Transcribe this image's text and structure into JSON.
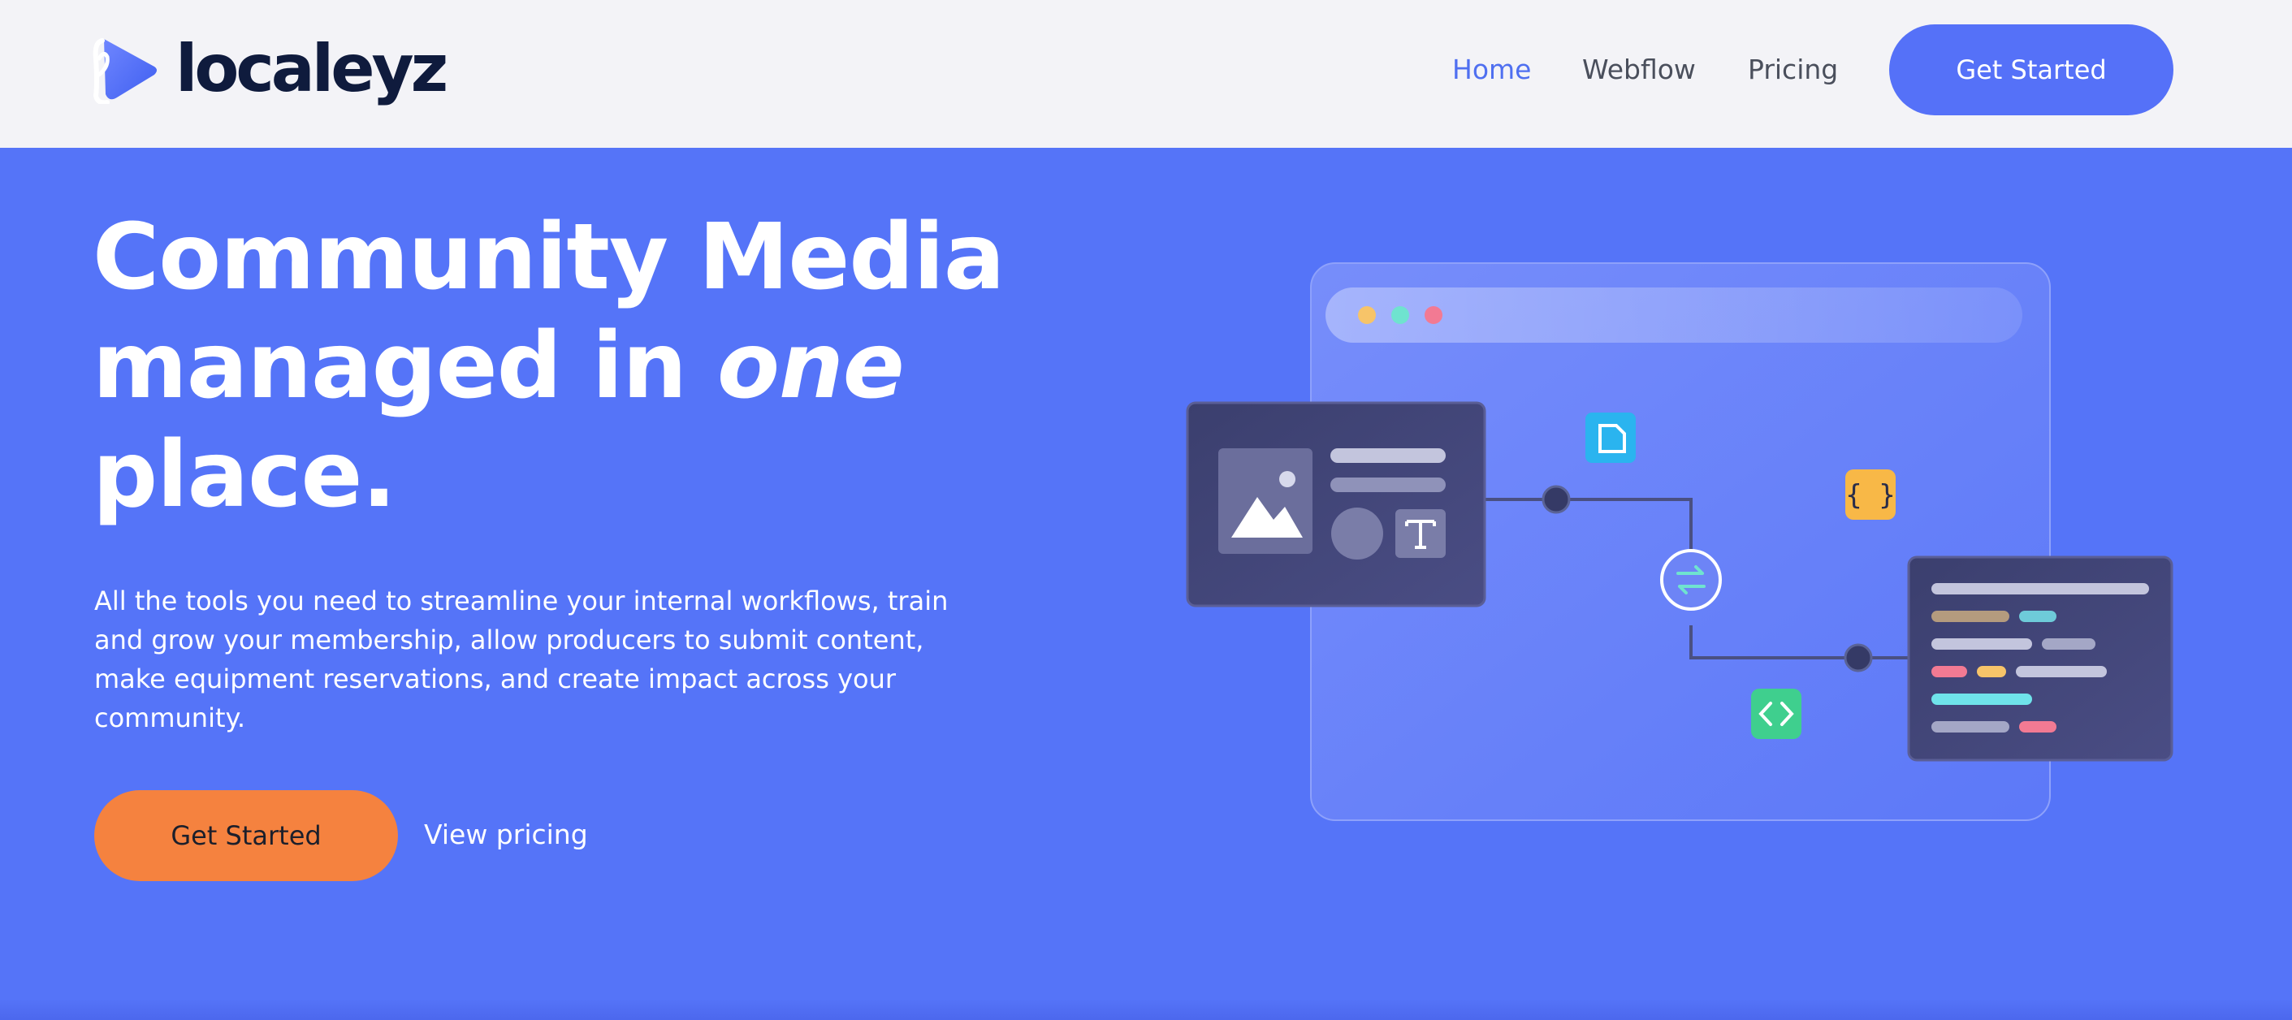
{
  "brand": {
    "name": "localeyz"
  },
  "nav": {
    "links": [
      {
        "label": "Home",
        "active": true
      },
      {
        "label": "Webflow",
        "active": false
      },
      {
        "label": "Pricing",
        "active": false
      }
    ],
    "cta_label": "Get Started"
  },
  "hero": {
    "title_line1": "Community Media",
    "title_line2_start": "managed in ",
    "title_line2_em": "one",
    "title_line3": "place.",
    "description": "All the tools you need to streamline your internal workflows, train and grow your membership, allow producers to submit content, make equipment reservations, and create impact across your community.",
    "primary_cta": "Get Started",
    "secondary_cta": "View pricing"
  },
  "illustration": {
    "code_badge_text": "{ }"
  },
  "colors": {
    "background": "#5574f8",
    "nav_background": "#f3f3f7",
    "accent": "#5571f8",
    "primary_button": "#f5823f",
    "active_link": "#4f6ff0",
    "brand_text": "#0f1b3d"
  },
  "icons": {
    "logo": "localeyz-logo-icon",
    "image_placeholder": "image-icon",
    "text_tool": "text-icon",
    "document": "document-icon",
    "code_braces": "code-braces-icon",
    "sync": "sync-icon",
    "code_tag": "code-tag-icon"
  }
}
